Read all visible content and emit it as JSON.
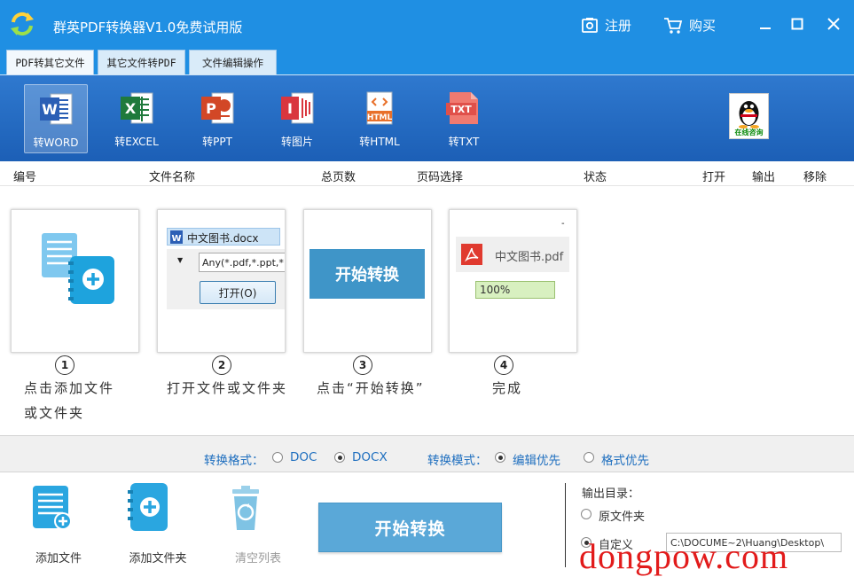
{
  "window": {
    "title": "群英PDF转换器V1.0免费试用版",
    "register": "注册",
    "buy": "购买"
  },
  "tabs": [
    {
      "label": "PDF转其它文件",
      "active": true
    },
    {
      "label": "其它文件转PDF",
      "active": false
    },
    {
      "label": "文件编辑操作",
      "active": false
    }
  ],
  "toolbar": {
    "items": [
      {
        "label": "转WORD",
        "icon": "word-icon",
        "color": "#2b5fb5",
        "letter": "W",
        "selected": true
      },
      {
        "label": "转EXCEL",
        "icon": "excel-icon",
        "color": "#1f7a3c",
        "letter": "X",
        "selected": false
      },
      {
        "label": "转PPT",
        "icon": "ppt-icon",
        "color": "#d24726",
        "letter": "P",
        "selected": false
      },
      {
        "label": "转图片",
        "icon": "image-icon",
        "color": "#d9363e",
        "letter": "I",
        "selected": false
      },
      {
        "label": "转HTML",
        "icon": "html-icon",
        "color": "#e8702a",
        "letter": "HTML",
        "selected": false
      },
      {
        "label": "转TXT",
        "icon": "txt-icon",
        "color": "#e0504a",
        "letter": "TXT",
        "selected": false
      }
    ],
    "consult_label": "在线咨询"
  },
  "list_header": {
    "number": "编号",
    "filename": "文件名称",
    "total_pages": "总页数",
    "page_select": "页码选择",
    "status": "状态",
    "open": "打开",
    "output": "输出",
    "remove": "移除"
  },
  "steps": [
    {
      "num": "1",
      "line1": "点击添加文件",
      "line2": "或文件夹"
    },
    {
      "num": "2",
      "line1": "打开文件或文件夹",
      "file_name": "中文图书.docx",
      "filter": "Any(*.pdf,*.ppt,*",
      "open_button": "打开(O)"
    },
    {
      "num": "3",
      "line1": "点击“开始转换”",
      "button": "开始转换"
    },
    {
      "num": "4",
      "line1": "完成",
      "file_name": "中文图书.pdf",
      "progress_text": "100%",
      "progress": 1.0
    }
  ],
  "options": {
    "format_label": "转换格式：",
    "format_doc": "DOC",
    "format_docx": "DOCX",
    "format_selected": "DOCX",
    "mode_label": "转换模式：",
    "mode_edit": "编辑优先",
    "mode_format": "格式优先",
    "mode_selected": "编辑优先"
  },
  "bottom": {
    "add_file": "添加文件",
    "add_folder": "添加文件夹",
    "clear_list": "清空列表",
    "start": "开始转换",
    "output_dir_label": "输出目录：",
    "source_folder": "原文件夹",
    "custom": "自定义",
    "custom_path": "C:\\DOCUME~2\\Huang\\Desktop\\",
    "output_selected": "自定义"
  },
  "watermark": "dongpow.com"
}
